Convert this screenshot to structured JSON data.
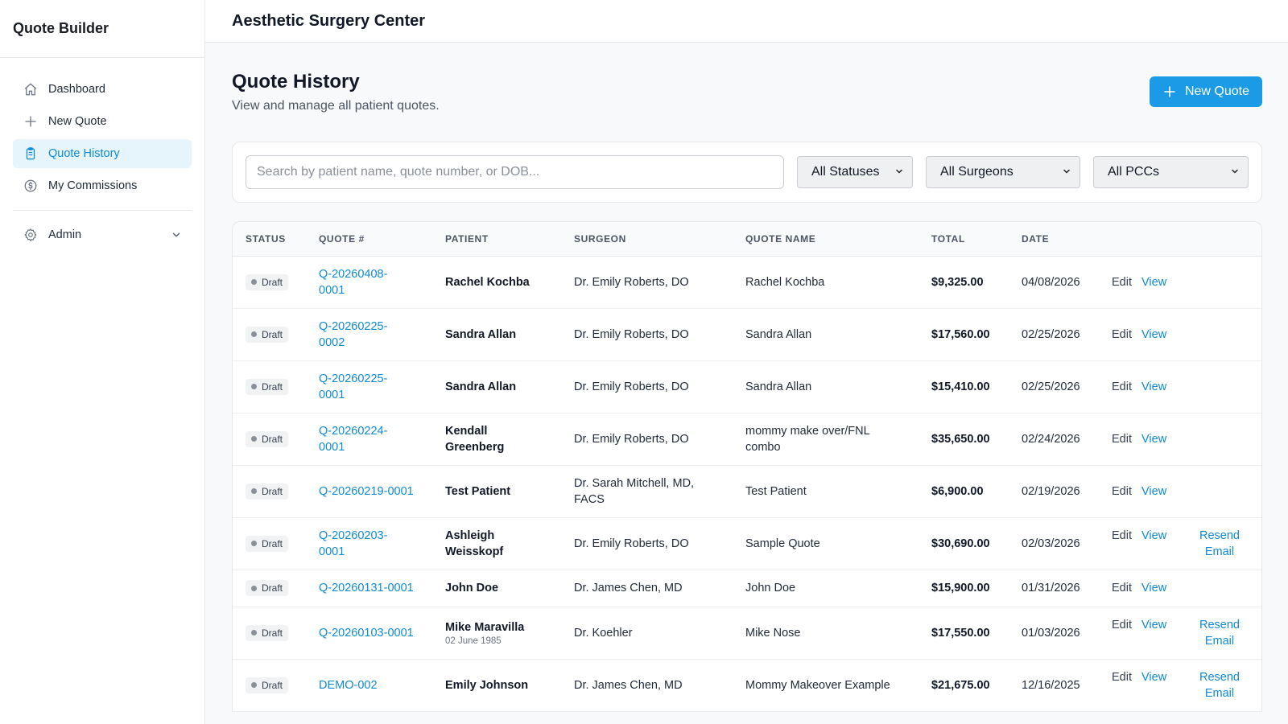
{
  "sidebar": {
    "brand": "Quote Builder",
    "items": [
      {
        "label": "Dashboard",
        "icon": "home-icon"
      },
      {
        "label": "New Quote",
        "icon": "plus-icon"
      },
      {
        "label": "Quote History",
        "icon": "clipboard-icon",
        "active": true
      },
      {
        "label": "My Commissions",
        "icon": "dollar-circle-icon"
      }
    ],
    "admin": {
      "label": "Admin",
      "icon": "gear-icon"
    }
  },
  "topbar": {
    "title": "Aesthetic Surgery Center"
  },
  "page": {
    "title": "Quote History",
    "subtitle": "View and manage all patient quotes.",
    "new_quote_label": "New Quote"
  },
  "filters": {
    "search_placeholder": "Search by patient name, quote number, or DOB...",
    "status": "All Statuses",
    "surgeon": "All Surgeons",
    "pcc": "All PCCs"
  },
  "table": {
    "headers": [
      "STATUS",
      "QUOTE #",
      "PATIENT",
      "SURGEON",
      "QUOTE NAME",
      "TOTAL",
      "DATE"
    ],
    "rows": [
      {
        "status": "Draft",
        "quote_l1": "Q-20260408-",
        "quote_l2": "0001",
        "patient": "Rachel Kochba",
        "dob": "",
        "surgeon": "Dr. Emily Roberts, DO",
        "quote_name": "Rachel Kochba",
        "total": "$9,325.00",
        "date": "04/08/2026",
        "edit": "Edit",
        "view": "View",
        "resend": ""
      },
      {
        "status": "Draft",
        "quote_l1": "Q-20260225-",
        "quote_l2": "0002",
        "patient": "Sandra Allan",
        "dob": "",
        "surgeon": "Dr. Emily Roberts, DO",
        "quote_name": "Sandra Allan",
        "total": "$17,560.00",
        "date": "02/25/2026",
        "edit": "Edit",
        "view": "View",
        "resend": ""
      },
      {
        "status": "Draft",
        "quote_l1": "Q-20260225-",
        "quote_l2": "0001",
        "patient": "Sandra Allan",
        "dob": "",
        "surgeon": "Dr. Emily Roberts, DO",
        "quote_name": "Sandra Allan",
        "total": "$15,410.00",
        "date": "02/25/2026",
        "edit": "Edit",
        "view": "View",
        "resend": ""
      },
      {
        "status": "Draft",
        "quote_l1": "Q-20260224-",
        "quote_l2": "0001",
        "patient": "Kendall Greenberg",
        "dob": "",
        "surgeon": "Dr. Emily Roberts, DO",
        "quote_name": "mommy make over/FNL combo",
        "total": "$35,650.00",
        "date": "02/24/2026",
        "edit": "Edit",
        "view": "View",
        "resend": ""
      },
      {
        "status": "Draft",
        "quote_l1": "Q-20260219-0001",
        "quote_l2": "",
        "patient": "Test Patient",
        "dob": "",
        "surgeon": "Dr. Sarah Mitchell, MD, FACS",
        "quote_name": "Test Patient",
        "total": "$6,900.00",
        "date": "02/19/2026",
        "edit": "Edit",
        "view": "View",
        "resend": ""
      },
      {
        "status": "Draft",
        "quote_l1": "Q-20260203-",
        "quote_l2": "0001",
        "patient": "Ashleigh Weisskopf",
        "dob": "",
        "surgeon": "Dr. Emily Roberts, DO",
        "quote_name": "Sample Quote",
        "total": "$30,690.00",
        "date": "02/03/2026",
        "edit": "Edit",
        "view": "View",
        "resend": "Resend Email"
      },
      {
        "status": "Draft",
        "quote_l1": "Q-20260131-0001",
        "quote_l2": "",
        "patient": "John Doe",
        "dob": "",
        "surgeon": "Dr. James Chen, MD",
        "quote_name": "John Doe",
        "total": "$15,900.00",
        "date": "01/31/2026",
        "edit": "Edit",
        "view": "View",
        "resend": ""
      },
      {
        "status": "Draft",
        "quote_l1": "Q-20260103-0001",
        "quote_l2": "",
        "patient": "Mike Maravilla",
        "dob": "02 June 1985",
        "surgeon": "Dr. Koehler",
        "quote_name": "Mike Nose",
        "total": "$17,550.00",
        "date": "01/03/2026",
        "edit": "Edit",
        "view": "View",
        "resend": "Resend Email"
      },
      {
        "status": "Draft",
        "quote_l1": "DEMO-002",
        "quote_l2": "",
        "patient": "Emily Johnson",
        "dob": "",
        "surgeon": "Dr. James Chen, MD",
        "quote_name": "Mommy Makeover Example",
        "total": "$21,675.00",
        "date": "12/16/2025",
        "edit": "Edit",
        "view": "View",
        "resend": "Resend Email"
      }
    ]
  }
}
